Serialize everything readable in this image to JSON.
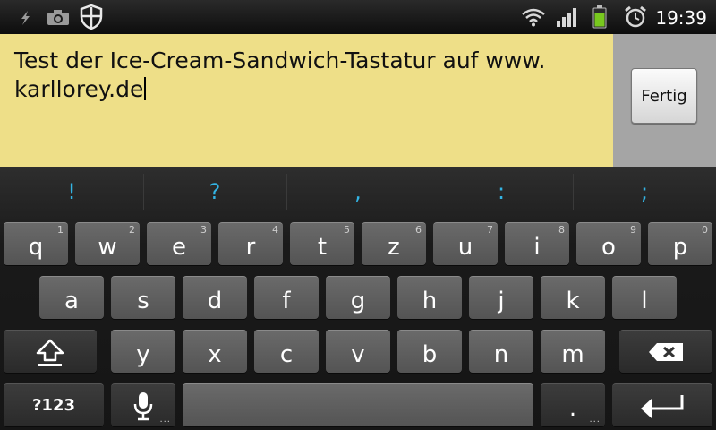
{
  "status_bar": {
    "time": "19:39",
    "left_icons": [
      "usb-debug-icon",
      "camera-icon",
      "shield-icon"
    ],
    "right_icons": [
      "wifi-icon",
      "signal-icon",
      "battery-icon",
      "alarm-icon"
    ]
  },
  "edit": {
    "text_line1": "Test der Ice-Cream-Sandwich-Tastatur auf www.",
    "text_line2": "karllorey.de"
  },
  "done_button": {
    "label": "Fertig"
  },
  "keyboard": {
    "suggestions": [
      "!",
      "?",
      ",",
      ":",
      ";"
    ],
    "row1": [
      {
        "label": "q",
        "hint": "1"
      },
      {
        "label": "w",
        "hint": "2"
      },
      {
        "label": "e",
        "hint": "3"
      },
      {
        "label": "r",
        "hint": "4"
      },
      {
        "label": "t",
        "hint": "5"
      },
      {
        "label": "z",
        "hint": "6"
      },
      {
        "label": "u",
        "hint": "7"
      },
      {
        "label": "i",
        "hint": "8"
      },
      {
        "label": "o",
        "hint": "9"
      },
      {
        "label": "p",
        "hint": "0"
      }
    ],
    "row2": [
      "a",
      "s",
      "d",
      "f",
      "g",
      "h",
      "j",
      "k",
      "l"
    ],
    "row3": [
      "y",
      "x",
      "c",
      "v",
      "b",
      "n",
      "m"
    ],
    "symbols_label": "?123",
    "period_label": ".",
    "mic_more": "...",
    "period_more": "..."
  }
}
